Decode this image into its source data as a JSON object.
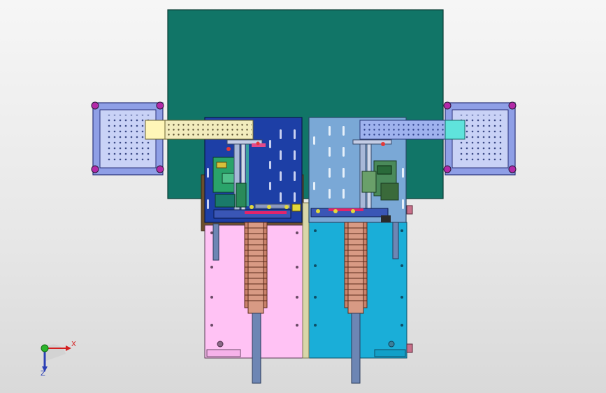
{
  "viewport": {
    "background_top": "#f6f6f6",
    "background_bottom": "#d9d9d9"
  },
  "colors": {
    "base_plate": "#117567",
    "left_station_plate": "#1d3fa6",
    "right_station_plate": "#7aa8d6",
    "left_lower_plate": "#ffc2f4",
    "right_lower_plate": "#1aaed8",
    "side_tray": "#8f9fe6",
    "conveyor_yellow": "#fff6b8",
    "conveyor_cyan": "#5fe3dc",
    "gear_copper": "#c9826a",
    "shaft_steel": "#6d86b4",
    "axis_x": "#d42020",
    "axis_y": "#2bb52b",
    "axis_z": "#2b3fb6"
  },
  "triad": {
    "x_label": "X",
    "y_label": "Z",
    "icons": [
      "axis-x-arrow-icon",
      "axis-z-arrow-icon",
      "origin-sphere-icon"
    ]
  }
}
